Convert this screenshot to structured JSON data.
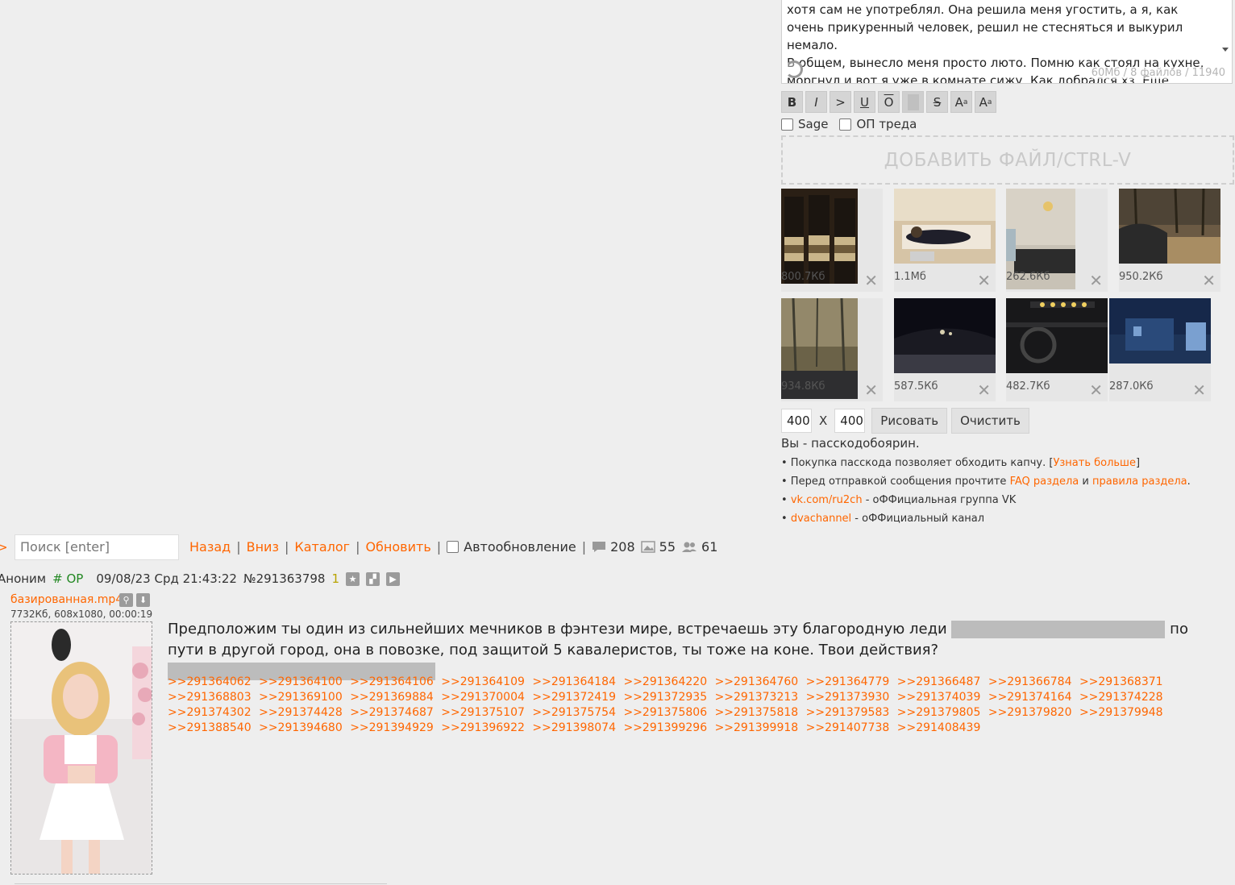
{
  "form": {
    "textarea_text": "хотя сам не употреблял. Она решила меня угостить, а я, как очень прикуренный человек, решил не стесняться и выкурил немало.\nВ общем, вынесло меня просто люто. Помню как стоял на кухне, моргнул и вот я уже в комнате сижу. Как добрался хз. Еще моргнул - уже она сидит рядом. Пытался включить музыку на ее",
    "counter": "60Мб / 8 файлов / 11940",
    "markup_buttons": [
      "B",
      "I",
      ">",
      "U",
      "O",
      "",
      "S",
      "Aa",
      "Aa"
    ],
    "sage_label": "Sage",
    "op_label": "ОП треда",
    "add_file_label": "ДОБАВИТЬ ФАЙЛ/CTRL-V",
    "thumbnails": [
      {
        "size": "800.7Кб",
        "palette": [
          "#2a1f15",
          "#6e5a3a",
          "#c9b58a"
        ]
      },
      {
        "size": "1.1Мб",
        "palette": [
          "#d6c4a6",
          "#1f1f2a",
          "#e8ddc8"
        ]
      },
      {
        "size": "262.6Кб",
        "palette": [
          "#c8c2b6",
          "#2c2c2c",
          "#e6c36a"
        ]
      },
      {
        "size": "950.2Кб",
        "palette": [
          "#6b5a44",
          "#2a2a2a",
          "#a88d63"
        ]
      },
      {
        "size": "934.8Кб",
        "palette": [
          "#6b6248",
          "#3e3c30",
          "#93886a"
        ]
      },
      {
        "size": "587.5Кб",
        "palette": [
          "#0c0c14",
          "#3a3a44",
          "#d8d0b0"
        ]
      },
      {
        "size": "482.7Кб",
        "palette": [
          "#18181a",
          "#2e2e30",
          "#f0d060"
        ]
      },
      {
        "size": "287.0Кб",
        "palette": [
          "#16284a",
          "#2a4a7a",
          "#7aa0d0"
        ]
      }
    ],
    "draw_width": "400",
    "draw_x": "X",
    "draw_height": "400",
    "draw_button": "Рисовать",
    "clear_button": "Очистить",
    "pass_title": "Вы - пасскодобоярин.",
    "info1_prefix": "• Покупка пасскода позволяет обходить капчу. [",
    "info1_link": "Узнать больше",
    "info1_suffix": "]",
    "info2_prefix": "• Перед отправкой сообщения прочтите ",
    "info2_link1": "FAQ раздела",
    "info2_mid": " и ",
    "info2_link2": "правила раздела",
    "info2_suffix": ".",
    "info3_link": "vk.com/ru2ch",
    "info3_suffix": " - оФФициальная группа VK",
    "info4_link": "dvachannel",
    "info4_suffix": " - оФФициальный канал"
  },
  "nav": {
    "caret": ">",
    "search_placeholder": "Поиск [enter]",
    "back": "Назад",
    "down": "Вниз",
    "catalog": "Каталог",
    "refresh": "Обновить",
    "sep": "|",
    "autoupdate": "Автообновление",
    "posts_count": "208",
    "images_count": "55",
    "posters_count": "61"
  },
  "post": {
    "author": "Аноним",
    "trip": "# OP",
    "datetime": "09/08/23 Срд 21:43:22",
    "number": "№291363798",
    "reply_count": "1",
    "file_name": "базированная.mp4",
    "file_meta": "7732Кб, 608x1080, 00:00:19",
    "text_part1": "Предположим ты один из сильнейших мечников в фэнтези мире, встречаешь эту благородную леди ",
    "text_part2": " по пути в другой город, она в повозке, под защитой 5 кавалеристов, ты тоже на коне. Твои действия? ",
    "replies": [
      ">>291364062",
      ">>291364100",
      ">>291364106",
      ">>291364109",
      ">>291364184",
      ">>291364220",
      ">>291364760",
      ">>291364779",
      ">>291366487",
      ">>291366784",
      ">>291368371",
      ">>291368803",
      ">>291369100",
      ">>291369884",
      ">>291370004",
      ">>291372419",
      ">>291372935",
      ">>291373213",
      ">>291373930",
      ">>291374039",
      ">>291374164",
      ">>291374228",
      ">>291374302",
      ">>291374428",
      ">>291374687",
      ">>291375107",
      ">>291375754",
      ">>291375806",
      ">>291375818",
      ">>291379583",
      ">>291379805",
      ">>291379820",
      ">>291379948",
      ">>291388540",
      ">>291394680",
      ">>291394929",
      ">>291396922",
      ">>291398074",
      ">>291399296",
      ">>291399918",
      ">>291407738",
      ">>291408439"
    ]
  },
  "colors": {
    "accent": "#ff6600",
    "background": "#eeeeee",
    "trip": "#228822",
    "spoiler": "#bcbcbc"
  }
}
